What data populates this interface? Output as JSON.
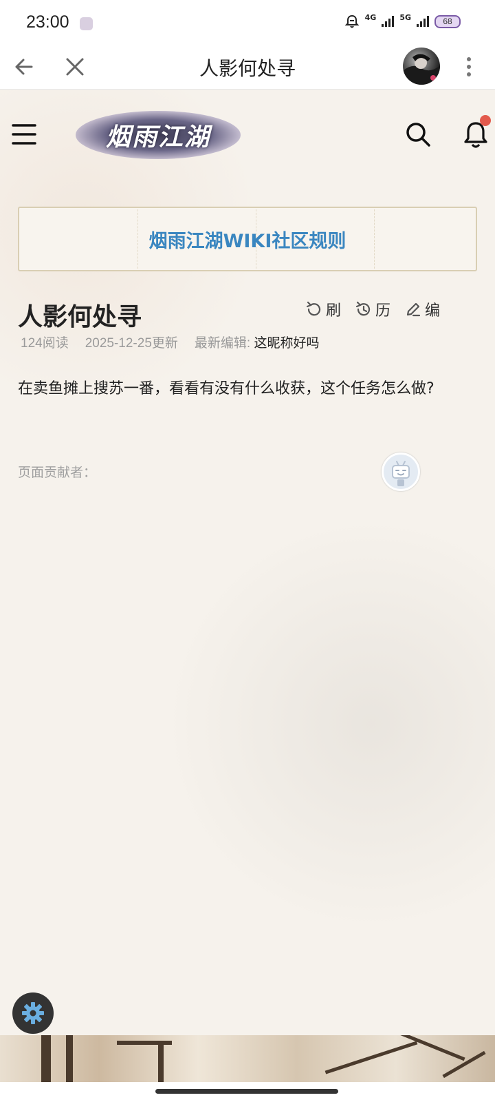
{
  "status_bar": {
    "time": "23:00",
    "network_1": "4G",
    "network_2": "5G",
    "battery": "68"
  },
  "app_bar": {
    "title": "人影何处寻"
  },
  "header": {
    "logo_text": "烟雨江湖"
  },
  "banner": {
    "text": "烟雨江湖WIKI社区规则"
  },
  "article": {
    "title": "人影何处寻",
    "actions": {
      "refresh": "刷",
      "history": "历",
      "edit": "编"
    },
    "meta": {
      "reads": "124阅读",
      "updated": "2025-12-25更新",
      "editor_label": "最新编辑:",
      "editor_name": "这昵称好吗"
    },
    "content": "在卖鱼摊上搜苏一番，看看有没有什么收获，这个任务怎么做?",
    "contributors_label": "页面贡献者："
  },
  "icons": {
    "back": "arrow-left-icon",
    "close": "close-icon",
    "more": "more-vertical-icon",
    "menu": "hamburger-icon",
    "search": "search-icon",
    "bell": "bell-icon",
    "settings": "gear-icon"
  },
  "colors": {
    "link_blue": "#3a86c0",
    "notification_red": "#e35a4c",
    "page_bg": "#f6f2ec"
  }
}
